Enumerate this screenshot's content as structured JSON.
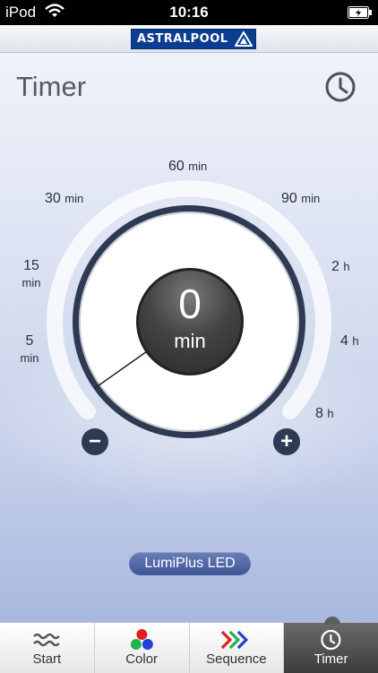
{
  "status_bar": {
    "carrier": "iPod",
    "time": "10:16"
  },
  "brand": {
    "logo_text": "ASTRALPOOL"
  },
  "screen": {
    "title": "Timer"
  },
  "dial": {
    "labels": [
      {
        "n": "60",
        "u": "min"
      },
      {
        "n": "30",
        "u": "min"
      },
      {
        "n": "90",
        "u": "min"
      },
      {
        "n": "15",
        "u": "min"
      },
      {
        "n": "2",
        "u": "h"
      },
      {
        "n": "5",
        "u": "min"
      },
      {
        "n": "4",
        "u": "h"
      },
      {
        "n": "8",
        "u": "h"
      }
    ],
    "value": "0",
    "unit": "min",
    "minus_symbol": "−",
    "plus_symbol": "+"
  },
  "device": {
    "name": "LumiPlus LED"
  },
  "tabs": [
    {
      "label": "Start",
      "icon": "waves-icon"
    },
    {
      "label": "Color",
      "icon": "rgb-dots-icon"
    },
    {
      "label": "Sequence",
      "icon": "chevrons-icon"
    },
    {
      "label": "Timer",
      "icon": "clock-icon",
      "active": true
    }
  ],
  "colors": {
    "accent": "#0b3d91",
    "dial_ring": "#2e3a52",
    "tab_active": "#4a4a4a"
  }
}
